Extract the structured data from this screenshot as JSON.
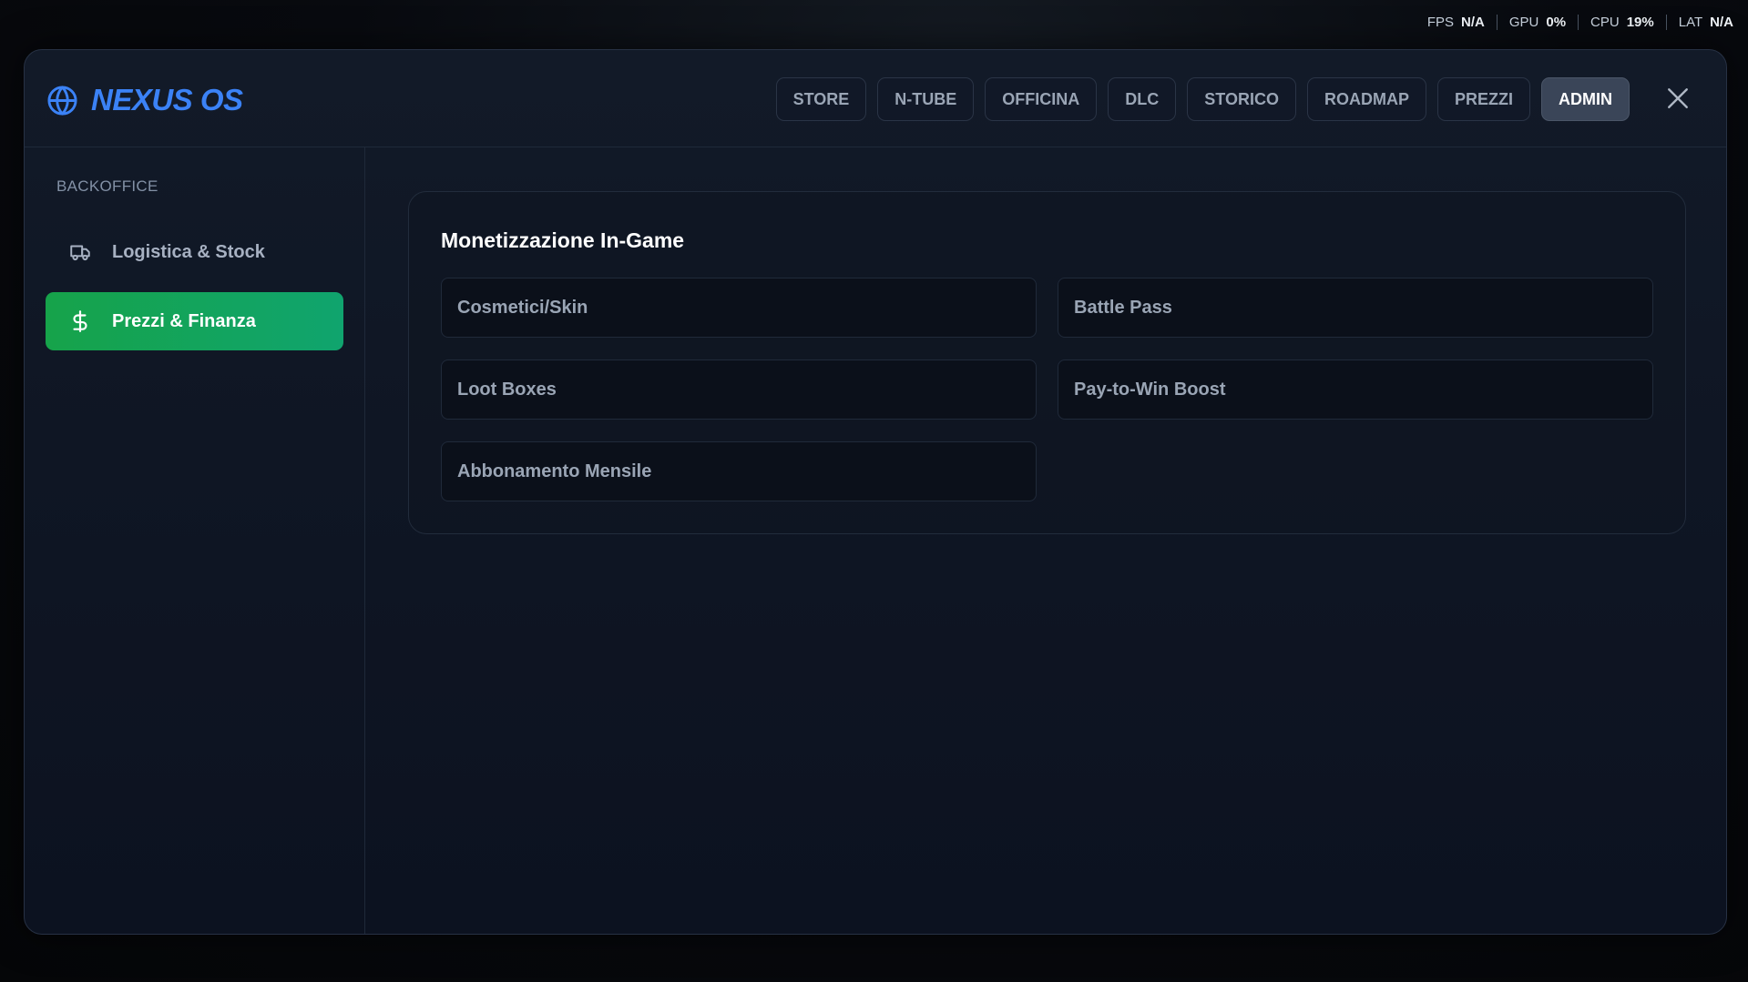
{
  "stats": [
    {
      "label": "FPS",
      "value": "N/A"
    },
    {
      "label": "GPU",
      "value": "0%"
    },
    {
      "label": "CPU",
      "value": "19%"
    },
    {
      "label": "LAT",
      "value": "N/A"
    }
  ],
  "app": {
    "title": "NEXUS OS"
  },
  "tabs": [
    {
      "label": "STORE",
      "active": false
    },
    {
      "label": "N-TUBE",
      "active": false
    },
    {
      "label": "OFFICINA",
      "active": false
    },
    {
      "label": "DLC",
      "active": false
    },
    {
      "label": "STORICO",
      "active": false
    },
    {
      "label": "ROADMAP",
      "active": false
    },
    {
      "label": "PREZZI",
      "active": false
    },
    {
      "label": "ADMIN",
      "active": true
    }
  ],
  "sidebar": {
    "title": "BACKOFFICE",
    "items": [
      {
        "label": "Logistica & Stock",
        "icon": "truck-icon",
        "active": false
      },
      {
        "label": "Prezzi & Finanza",
        "icon": "dollar-icon",
        "active": true
      }
    ]
  },
  "main": {
    "section_title": "Monetizzazione In-Game",
    "options": [
      "Cosmetici/Skin",
      "Battle Pass",
      "Loot Boxes",
      "Pay-to-Win Boost",
      "Abbonamento Mensile"
    ]
  },
  "colors": {
    "accent": "#3b82f6",
    "active_green": "#16a34a",
    "active_tab": "#3a4558"
  }
}
